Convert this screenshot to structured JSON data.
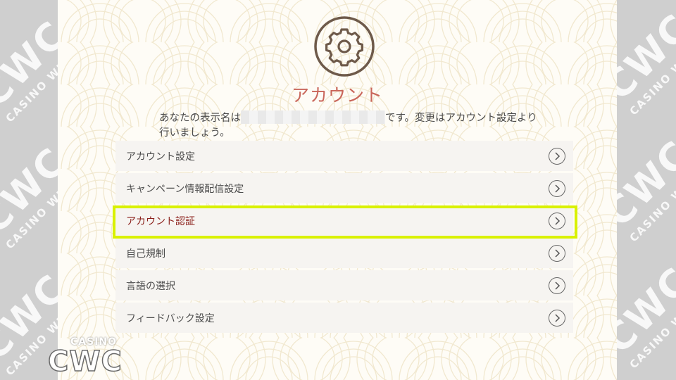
{
  "watermark": {
    "big": "CWC",
    "small": "CASINO  WINNER'S CLUB"
  },
  "header": {
    "icon": "gear-icon",
    "title": "アカウント"
  },
  "message": {
    "prefix": "あなたの表示名は",
    "suffix": "です。変更はアカウント設定より行いましょう。"
  },
  "menu": {
    "items": [
      {
        "label": "アカウント設定"
      },
      {
        "label": "キャンペーン情報配信設定"
      },
      {
        "label": "アカウント認証"
      },
      {
        "label": "自己規制"
      },
      {
        "label": "言語の選択"
      },
      {
        "label": "フィードバック設定"
      }
    ]
  },
  "logo": {
    "casino": "CASINO",
    "cwc": "CWC"
  },
  "colors": {
    "title": "#c9665a",
    "active_label": "#8b1f1a",
    "highlight": "#d9f100",
    "gear": "#6e5a4a"
  }
}
